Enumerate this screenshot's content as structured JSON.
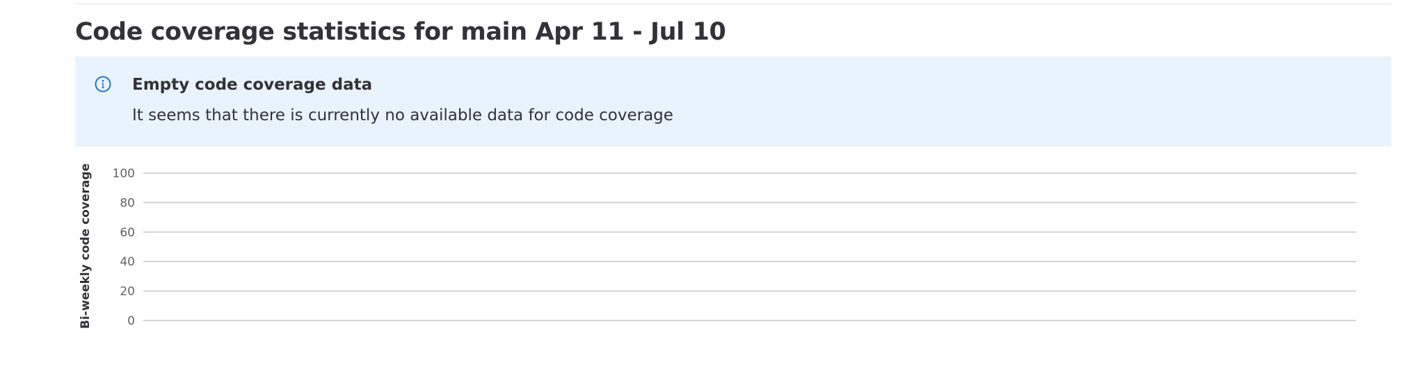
{
  "page": {
    "title": "Code coverage statistics for main Apr 11 - Jul 10"
  },
  "alert": {
    "icon": "info-icon",
    "title": "Empty code coverage data",
    "body": "It seems that there is currently no available data for code coverage",
    "background_color": "#e9f3fc",
    "icon_color": "#1f75cb"
  },
  "chart_data": {
    "type": "line",
    "title": "",
    "xlabel": "",
    "ylabel": "Bi-weekly code coverage",
    "ylim": [
      0,
      100
    ],
    "y_ticks": [
      0,
      20,
      40,
      60,
      80,
      100
    ],
    "grid": true,
    "series": []
  }
}
